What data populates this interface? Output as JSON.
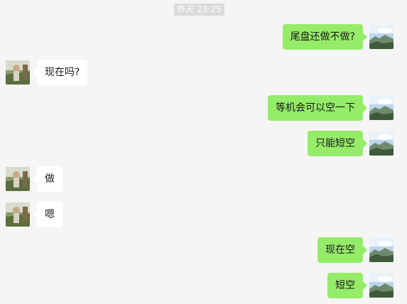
{
  "timestamp": "昨天 23:25",
  "messages": [
    {
      "sender": "me",
      "text": "尾盘还做不做?"
    },
    {
      "sender": "other",
      "text": "现在吗?"
    },
    {
      "sender": "me",
      "text": "等机会可以空一下"
    },
    {
      "sender": "me",
      "text": "只能短空"
    },
    {
      "sender": "other",
      "text": "做"
    },
    {
      "sender": "other",
      "text": "嗯"
    },
    {
      "sender": "me",
      "text": "现在空"
    },
    {
      "sender": "me",
      "text": "短空"
    }
  ],
  "colors": {
    "background": "#f5f5f5",
    "sent_bubble": "#95ec69",
    "received_bubble": "#ffffff",
    "timestamp_bg": "#dadada"
  }
}
